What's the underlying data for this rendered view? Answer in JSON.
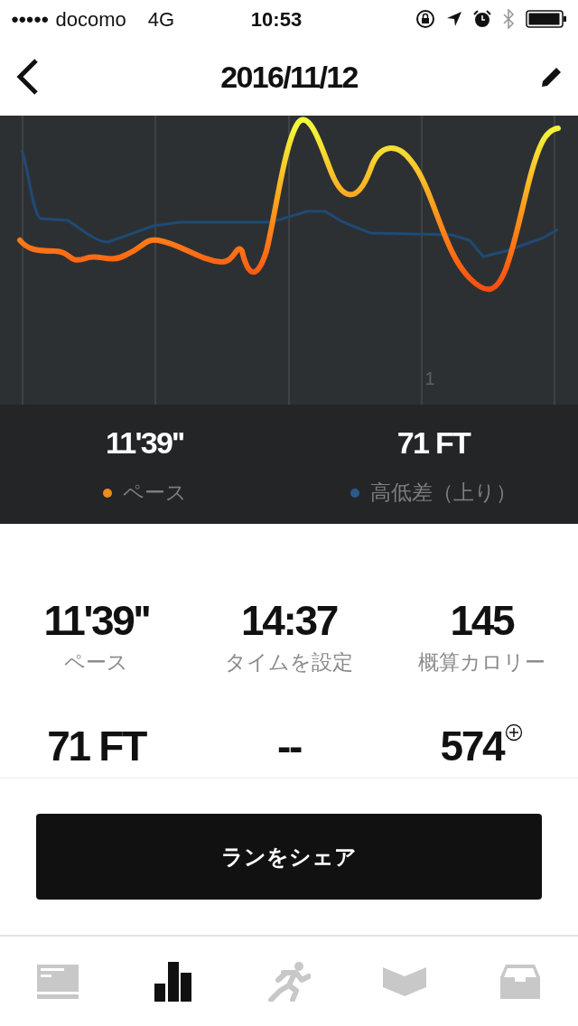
{
  "status_bar": {
    "signal_dots": "●●●●●",
    "carrier": "docomo",
    "network": "4G",
    "time": "10:53"
  },
  "nav": {
    "title": "2016/11/12"
  },
  "chart": {
    "x_label": "1"
  },
  "legend": [
    {
      "value": "11'39''",
      "label": "ペース",
      "color": "#f08a1c"
    },
    {
      "value": "71 FT",
      "label": "高低差（上り）",
      "color": "#2a5a8c"
    }
  ],
  "stats": [
    {
      "value": "11'39''",
      "label": "ペース"
    },
    {
      "value": "14:37",
      "label": "タイムを設定"
    },
    {
      "value": "145",
      "label": "概算カロリー"
    },
    {
      "value": "71 FT"
    },
    {
      "value": "--"
    },
    {
      "value": "574",
      "kind": "plus"
    }
  ],
  "share_button": "ランをシェア",
  "tabs": [
    {
      "kind": "card",
      "selected": false
    },
    {
      "kind": "bars",
      "selected": true
    },
    {
      "kind": "runner",
      "selected": false
    },
    {
      "kind": "banner",
      "selected": false
    },
    {
      "kind": "tray",
      "selected": false
    }
  ]
}
